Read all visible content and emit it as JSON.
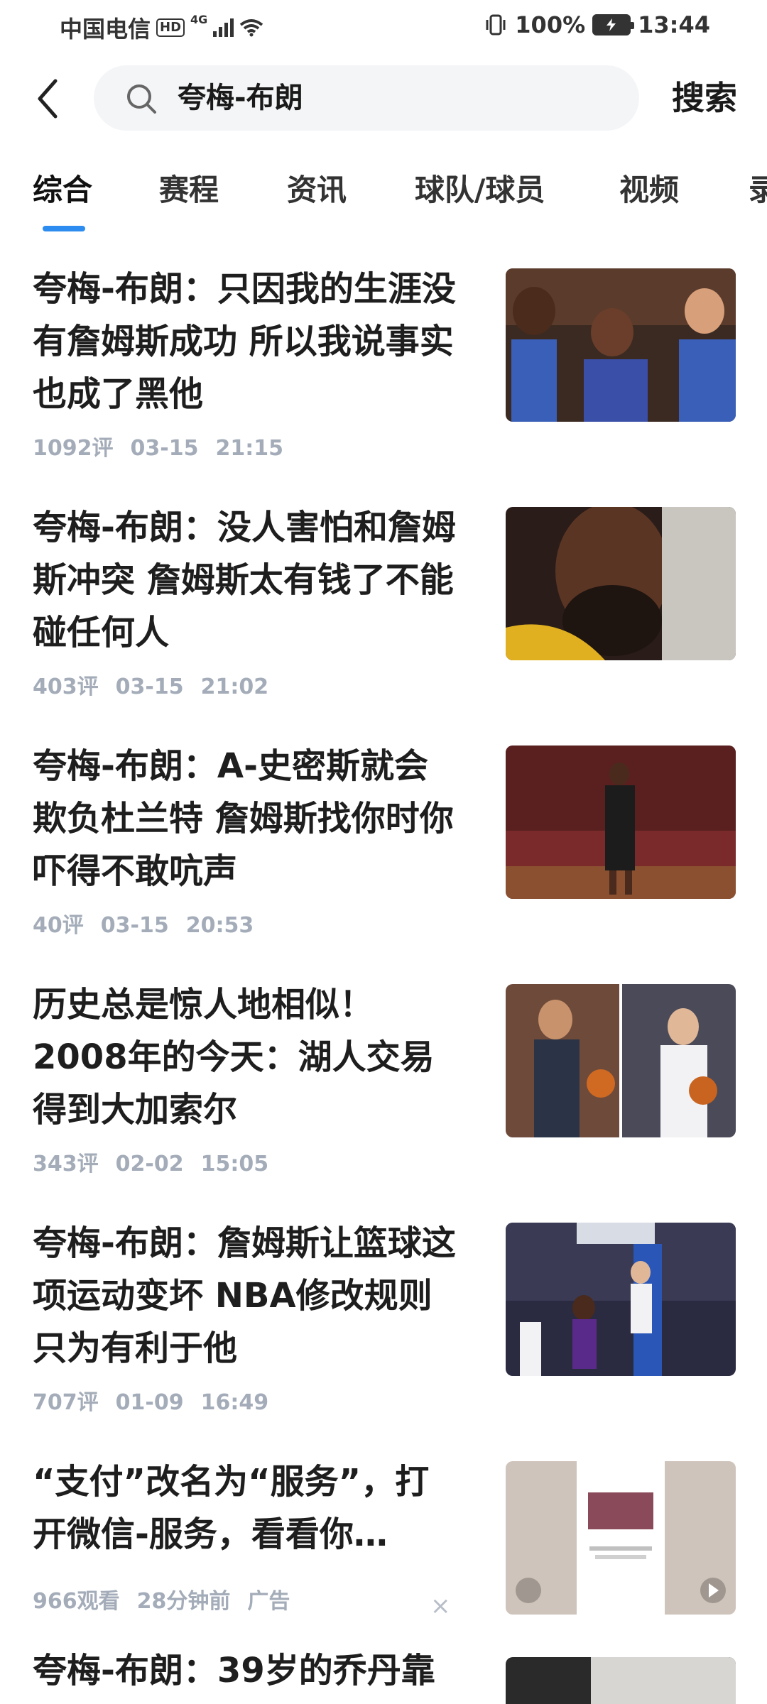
{
  "status_bar": {
    "carrier": "中国电信",
    "hd": "HD",
    "network": "4G",
    "battery": "100%",
    "time": "13:44"
  },
  "search": {
    "query": "夸梅-布朗",
    "button_label": "搜索"
  },
  "tabs": [
    {
      "label": "综合",
      "active": true
    },
    {
      "label": "赛程",
      "active": false
    },
    {
      "label": "资讯",
      "active": false
    },
    {
      "label": "球队/球员",
      "active": false
    },
    {
      "label": "视频",
      "active": false
    },
    {
      "label": "录",
      "active": false
    }
  ],
  "accent_color": "#2d8cf0",
  "news": [
    {
      "title": "夸梅-布朗：只因我的生涯没有詹姆斯成功 所以我说事实也成了黑他",
      "comments": "1092评",
      "date": "03-15",
      "time": "21:15",
      "thumb_icon": "basketball-players-photo"
    },
    {
      "title": "夸梅-布朗：没人害怕和詹姆斯冲突 詹姆斯太有钱了不能碰任何人",
      "comments": "403评",
      "date": "03-15",
      "time": "21:02",
      "thumb_icon": "player-portrait-photo"
    },
    {
      "title": "夸梅-布朗：A-史密斯就会欺负杜兰特 詹姆斯找你时你吓得不敢吭声",
      "comments": "40评",
      "date": "03-15",
      "time": "20:53",
      "thumb_icon": "player-court-photo"
    },
    {
      "title": "历史总是惊人地相似！2008年的今天：湖人交易得到大加索尔",
      "comments": "343评",
      "date": "02-02",
      "time": "15:05",
      "thumb_icon": "players-split-photo"
    },
    {
      "title": "夸梅-布朗：詹姆斯让篮球这项运动变坏 NBA修改规则只为有利于他",
      "comments": "707评",
      "date": "01-09",
      "time": "16:49",
      "thumb_icon": "game-action-photo"
    }
  ],
  "ad": {
    "title": "“支付”改名为“服务”，打开微信-服务，看看你…",
    "views": "966观看",
    "time_ago": "28分钟前",
    "tag": "广告",
    "close": "×"
  },
  "partial_item": {
    "title": "夸梅-布朗：39岁的乔丹靠"
  }
}
